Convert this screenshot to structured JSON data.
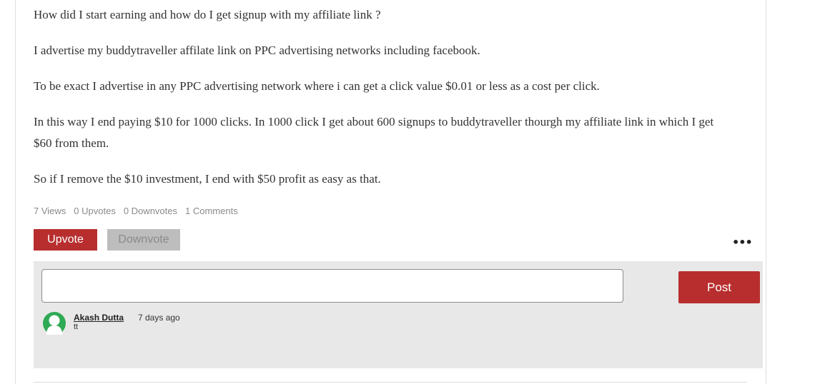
{
  "post": {
    "paragraphs": [
      "How did I start earning and how do I get signup with my affiliate link ?",
      "I advertise my buddytraveller affilate link on PPC advertising networks including facebook.",
      "To be exact I advertise in any PPC advertising network where i can get a click value $0.01 or less as a cost per click.",
      "In this way I end paying $10 for 1000 clicks. In 1000 click I get about 600 signups to buddytraveller thourgh my affiliate link in which I get $60 from them.",
      "So if I remove the $10 investment, I end with $50 profit as easy as that."
    ]
  },
  "stats": {
    "views": "7 Views",
    "upvotes": "0 Upvotes",
    "downvotes": "0 Downvotes",
    "comments": "1 Comments"
  },
  "actions": {
    "upvote_label": "Upvote",
    "downvote_label": "Downvote",
    "more_label": "•••"
  },
  "comment_box": {
    "input_value": "",
    "post_label": "Post"
  },
  "comments": [
    {
      "author": "Akash Dutta",
      "time": "7 days ago",
      "text": "tt",
      "avatar_icon": "user-avatar-icon"
    }
  ],
  "colors": {
    "accent": "#b82e2e",
    "disabled_button": "#bdbdbd",
    "panel_background": "#e8e8e8",
    "avatar_green": "#2eaa55"
  }
}
